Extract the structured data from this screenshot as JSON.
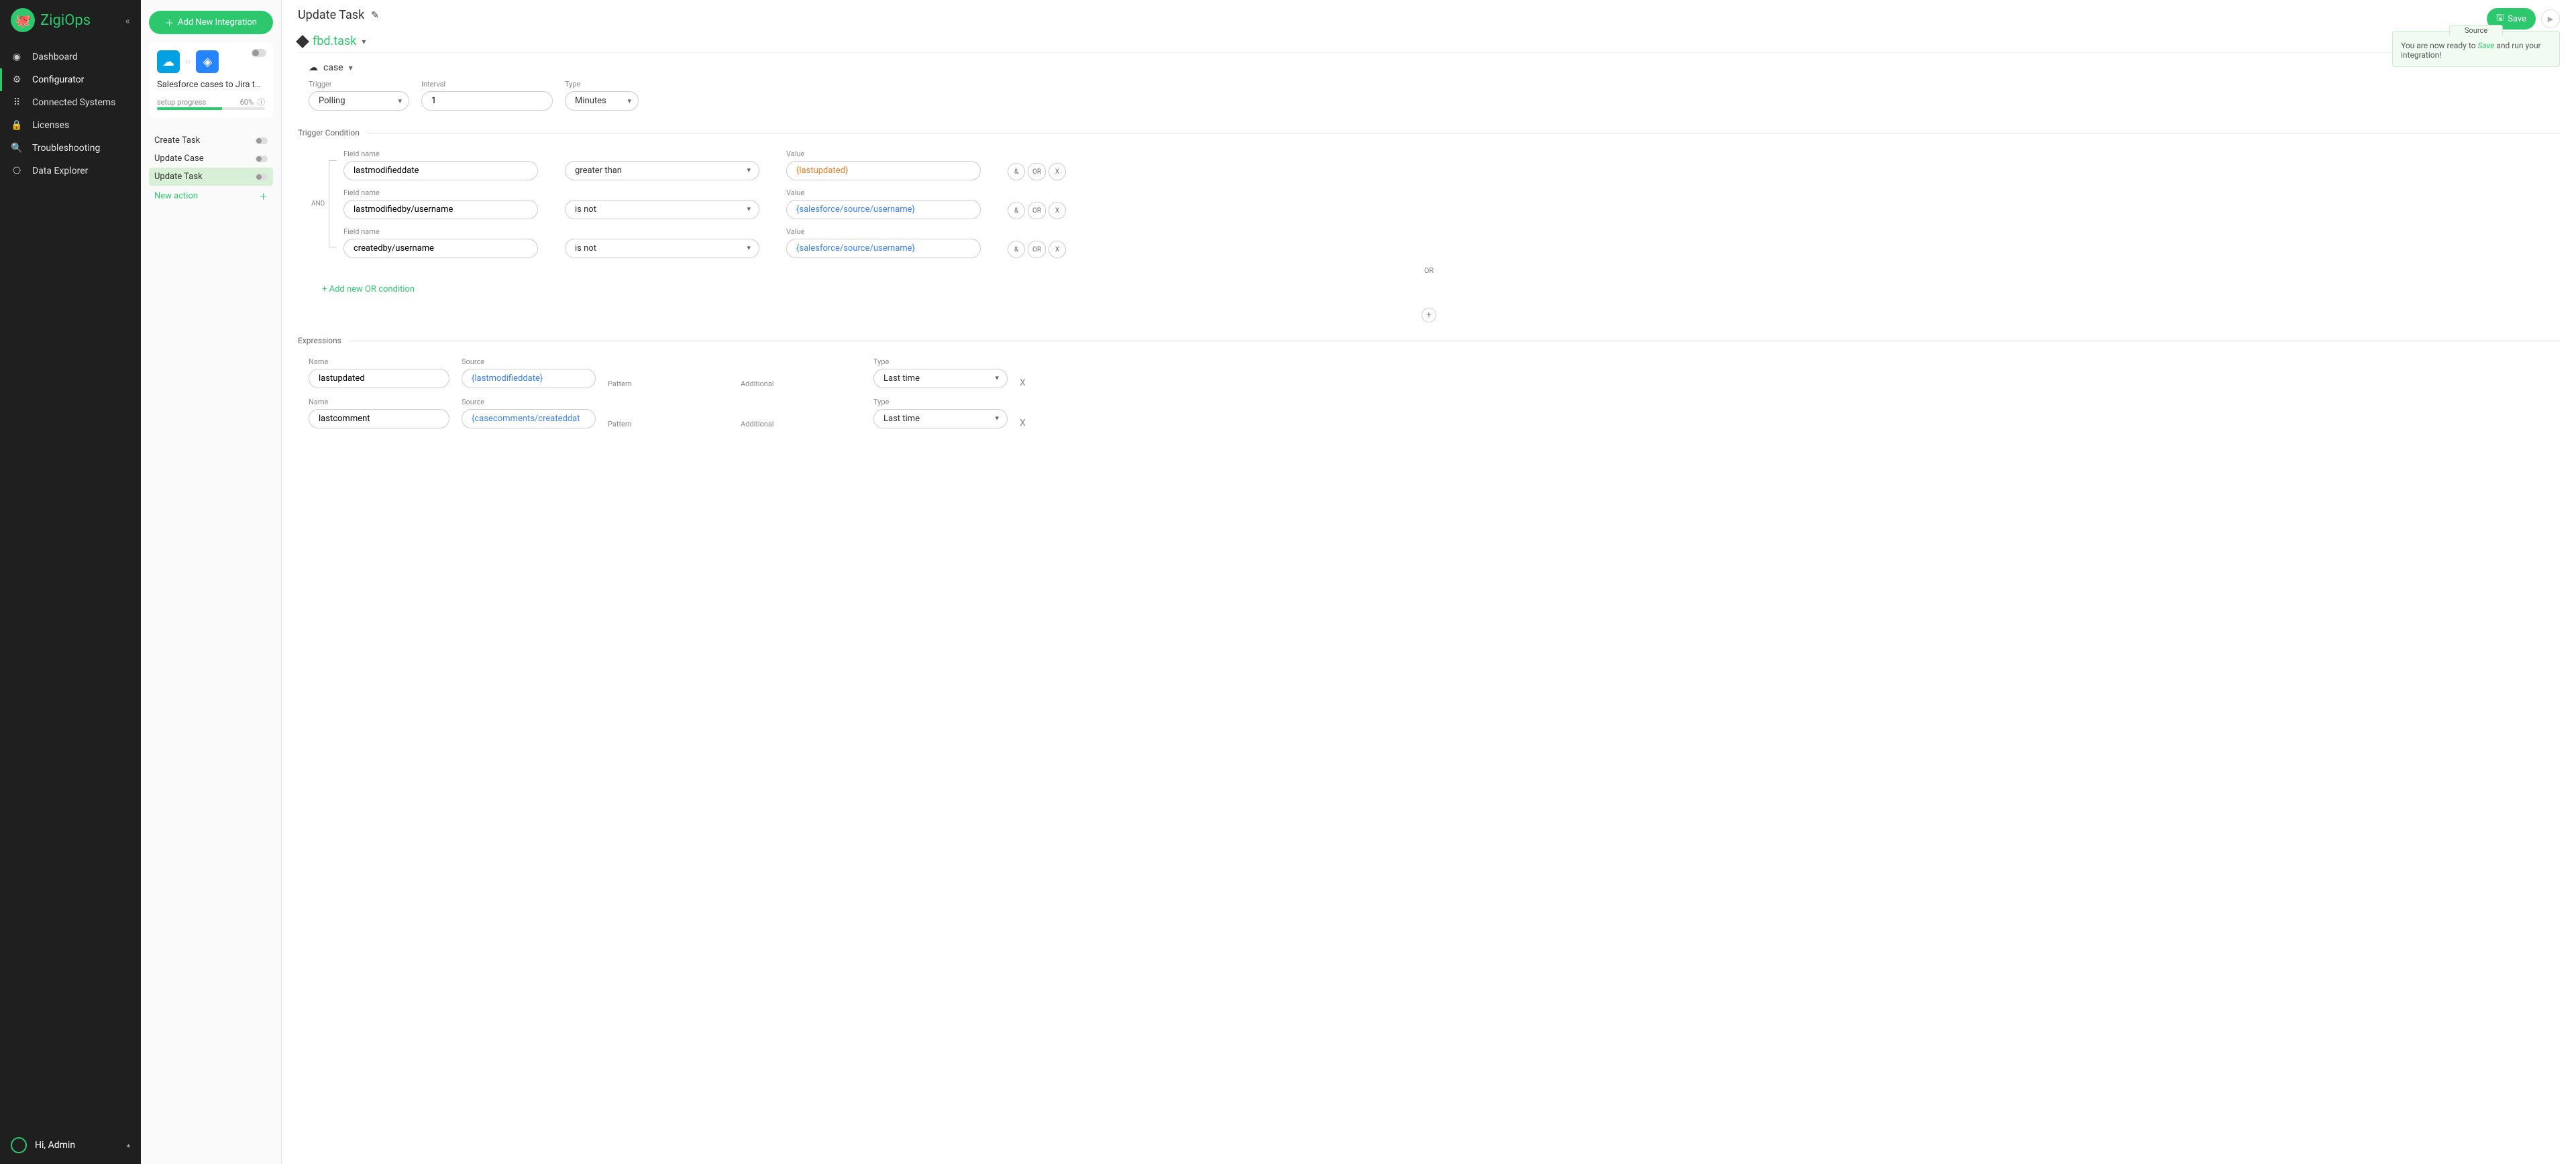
{
  "brand": "ZigiOps",
  "sidebar": {
    "items": [
      {
        "label": "Dashboard"
      },
      {
        "label": "Configurator"
      },
      {
        "label": "Connected Systems"
      },
      {
        "label": "Licenses"
      },
      {
        "label": "Troubleshooting"
      },
      {
        "label": "Data Explorer"
      }
    ],
    "user": "Hi, Admin"
  },
  "panel": {
    "add_btn": "Add New Integration",
    "integration_title": "Salesforce cases to Jira t…",
    "progress_label": "setup progress",
    "progress_pct": "60%",
    "actions": [
      {
        "label": "Create Task"
      },
      {
        "label": "Update Case"
      },
      {
        "label": "Update Task"
      },
      {
        "label": "New action"
      }
    ]
  },
  "main": {
    "title": "Update Task",
    "crumb": "fbd.task",
    "sub": "case",
    "save": "Save",
    "hint": {
      "tab": "Source",
      "prefix": "You are now ready to ",
      "save_word": "Save",
      "suffix": " and run your integration!"
    },
    "trigger": {
      "trigger_label": "Trigger",
      "trigger_value": "Polling",
      "interval_label": "Interval",
      "interval_value": "1",
      "type_label": "Type",
      "type_value": "Minutes"
    },
    "sections": {
      "cond": "Trigger Condition",
      "expr": "Expressions"
    },
    "cond": {
      "and": "AND",
      "field_label": "Field name",
      "value_label": "Value",
      "rows": [
        {
          "field": "lastmodifieddate",
          "op": "greater than",
          "value": "{lastupdated}",
          "val_class": "val-orange"
        },
        {
          "field": "lastmodifiedby/username",
          "op": "is not",
          "value": "{salesforce/source/username}",
          "val_class": "val-blue"
        },
        {
          "field": "createdby/username",
          "op": "is not",
          "value": "{salesforce/source/username}",
          "val_class": "val-blue"
        }
      ],
      "or_label": "OR",
      "add_or": "+ Add new OR condition",
      "btn_and": "&",
      "btn_or": "OR",
      "btn_x": "X"
    },
    "expr_headers": {
      "name": "Name",
      "source": "Source",
      "pattern": "Pattern",
      "additional": "Additional",
      "type": "Type"
    },
    "expr_rows": [
      {
        "name": "lastupdated",
        "source": "{lastmodifieddate}",
        "type": "Last time"
      },
      {
        "name": "lastcomment",
        "source": "{casecomments/createddat",
        "type": "Last time"
      }
    ]
  }
}
